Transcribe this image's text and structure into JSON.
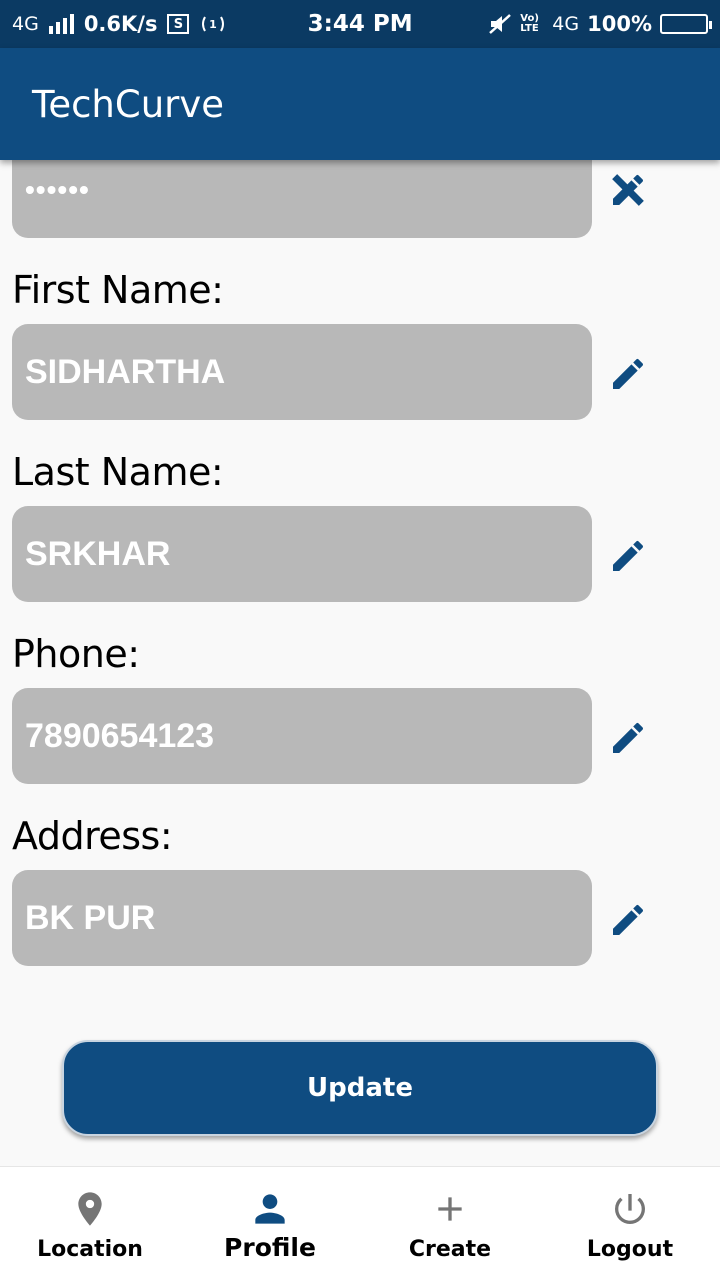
{
  "status_bar": {
    "network": "4G",
    "speed": "0.6K/s",
    "sim_icon": "S",
    "time": "3:44 PM",
    "volte": "Vo) LTE",
    "network_right": "4G",
    "battery": "100%"
  },
  "app_bar": {
    "title": "TechCurve"
  },
  "form": {
    "password": {
      "value": "••••••",
      "icon": "edit-off-icon"
    },
    "first_name": {
      "label": "First Name:",
      "value": "SIDHARTHA"
    },
    "last_name": {
      "label": "Last Name:",
      "value": "SRKHAR"
    },
    "phone": {
      "label": "Phone:",
      "value": "7890654123"
    },
    "address": {
      "label": "Address:",
      "value": "BK PUR"
    },
    "update_label": "Update"
  },
  "bottom_nav": {
    "items": [
      {
        "label": "Location",
        "icon": "location-pin-icon"
      },
      {
        "label": "Profile",
        "icon": "person-icon",
        "active": true
      },
      {
        "label": "Create",
        "icon": "plus-icon"
      },
      {
        "label": "Logout",
        "icon": "power-icon"
      }
    ]
  },
  "colors": {
    "primary": "#0f4c81",
    "status_bar": "#0b3a63",
    "field_bg": "#b8b8b8",
    "background": "#f9f9f9"
  }
}
